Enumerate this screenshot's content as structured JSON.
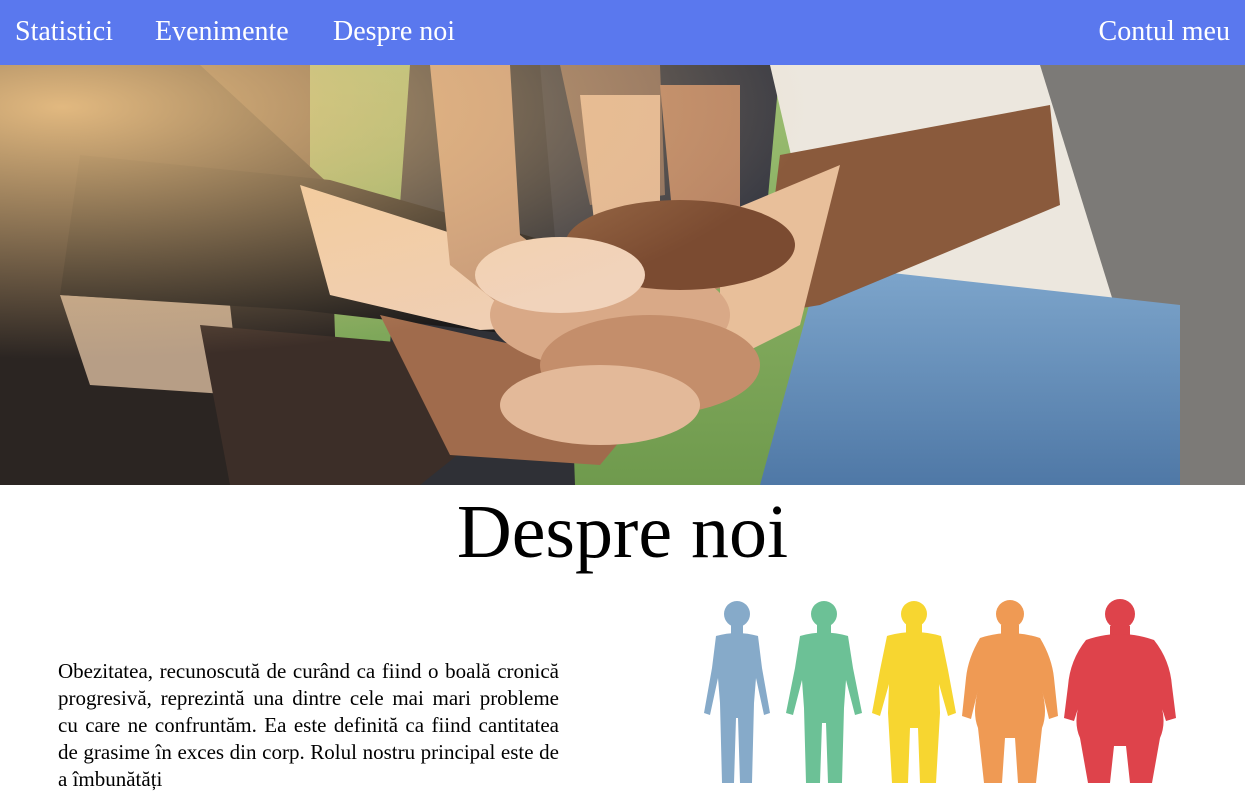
{
  "nav": {
    "items": [
      {
        "label": "Statistici"
      },
      {
        "label": "Evenimente"
      },
      {
        "label": "Despre noi"
      }
    ],
    "account_label": "Contul meu",
    "background": "#5a78ee"
  },
  "main": {
    "title": "Despre noi",
    "paragraph": "Obezitatea, recunoscută de curând ca fiind o boală cronică progresivă, reprezintă una dintre cele mai mari probleme cu care ne confruntăm. Ea este definită ca fiind cantitatea de grasime în exces din corp. Rolul nostru principal este de a îmbunătăți"
  },
  "illustration": {
    "figure_colors": [
      "#86aac9",
      "#6cc196",
      "#f7d630",
      "#ef9a54",
      "#de434b"
    ]
  }
}
